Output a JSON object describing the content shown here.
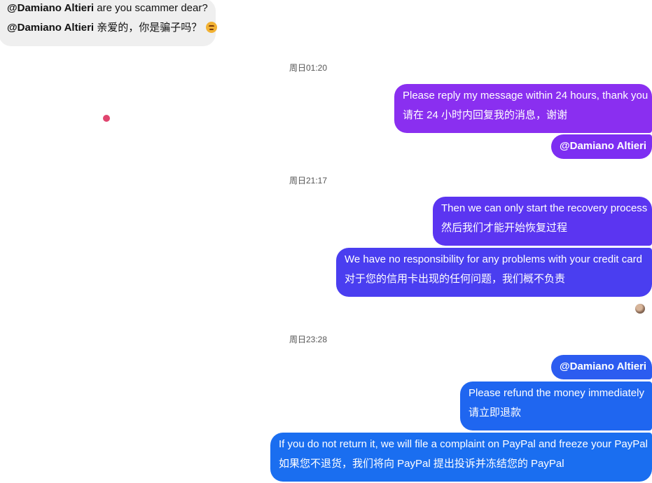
{
  "incoming": {
    "mention": "@Damiano Altieri",
    "line1_text": " are you scammer dear?",
    "line2_text": " 亲爱的，你是骗子吗？",
    "emoji": "angry-face-emoji"
  },
  "timestamps": {
    "t1": "周日01:20",
    "t2": "周日21:17",
    "t3": "周日23:28"
  },
  "outgoing": [
    {
      "line1": "Please reply my message within 24 hours, thank you",
      "line2": "请在 24 小时内回复我的消息，谢谢"
    },
    {
      "line1": "@Damiano Altieri"
    },
    {
      "line1": "Then we can only start the recovery process",
      "line2": "然后我们才能开始恢复过程"
    },
    {
      "line1": "We have no responsibility for any problems with your credit card",
      "line2": "对于您的信用卡出现的任何问题，我们概不负责"
    },
    {
      "line1": "@Damiano Altieri"
    },
    {
      "line1": "Please refund the money immediately",
      "line2": "请立即退款"
    },
    {
      "line1": "If you do not return it, we will file a complaint on PayPal and freeze your PayPal",
      "line2": "如果您不退货，我们将向 PayPal 提出投诉并冻结您的 PayPal"
    }
  ],
  "colors": {
    "incoming_bg": "#efefef",
    "outgoing_purple": "#8a2ff0",
    "outgoing_blue": "#1a6ef0",
    "dot": "#e0456f"
  },
  "icons": {
    "read_receipt": "avatar-icon"
  }
}
